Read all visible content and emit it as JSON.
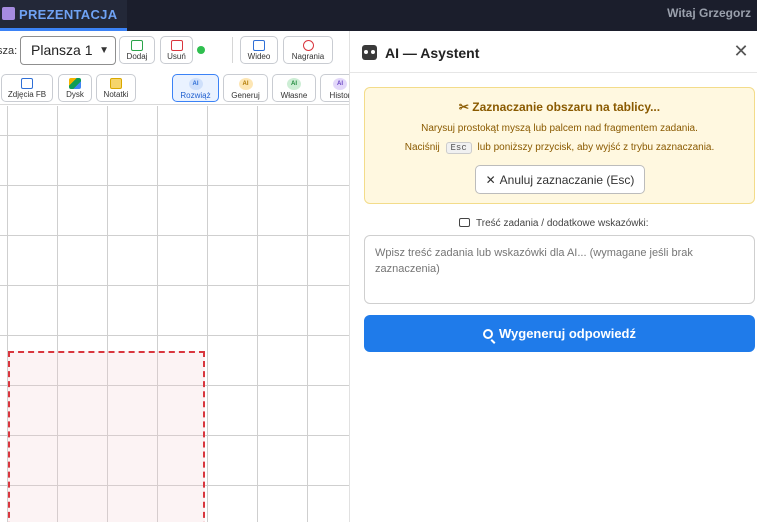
{
  "topbar": {
    "brand": "PREZENTACJA",
    "greeting": "Witaj Grzegorz"
  },
  "toolbar": {
    "board_label": "sza:",
    "board_select": "Plansza 1",
    "add_label": "Dodaj",
    "remove_label": "Usuń",
    "video_label": "Wideo",
    "recordings_label": "Nagrania"
  },
  "toolbar2": {
    "photos_label": "Zdjęcia FB",
    "drive_label": "Dysk",
    "notes_label": "Notatki",
    "solve_label": "Rozwiąż",
    "generate_label": "Generuj",
    "own_label": "Własne",
    "history_label": "Histor",
    "chip_text": "AI"
  },
  "panel": {
    "title": "AI — Asystent",
    "notice_title": "✂ Zaznaczanie obszaru na tablicy...",
    "notice_line1": "Narysuj prostokąt myszą lub palcem nad fragmentem zadania.",
    "notice_line2_pre": "Naciśnij",
    "notice_key": "Esc",
    "notice_line2_post": "lub poniższy przycisk, aby wyjść z trybu zaznaczania.",
    "cancel_label": "Anuluj zaznaczanie (Esc)",
    "field_label": "Treść zadania / dodatkowe wskazówki:",
    "textarea_placeholder": "Wpisz treść zadania lub wskazówki dla AI... (wymagane jeśli brak zaznaczenia)",
    "generate_button": "Wygeneruj odpowiedź"
  },
  "colors": {
    "accent": "#1f7bea",
    "notice_bg": "#fff8e0",
    "selection_border": "#d9363e",
    "status_online": "#2fbf4f"
  },
  "icons": [
    "brand-icon",
    "robot-icon",
    "close-icon",
    "scissors-icon",
    "chat-icon",
    "search-icon",
    "video-icon",
    "record-icon",
    "camera-icon",
    "drive-icon",
    "notes-icon"
  ]
}
